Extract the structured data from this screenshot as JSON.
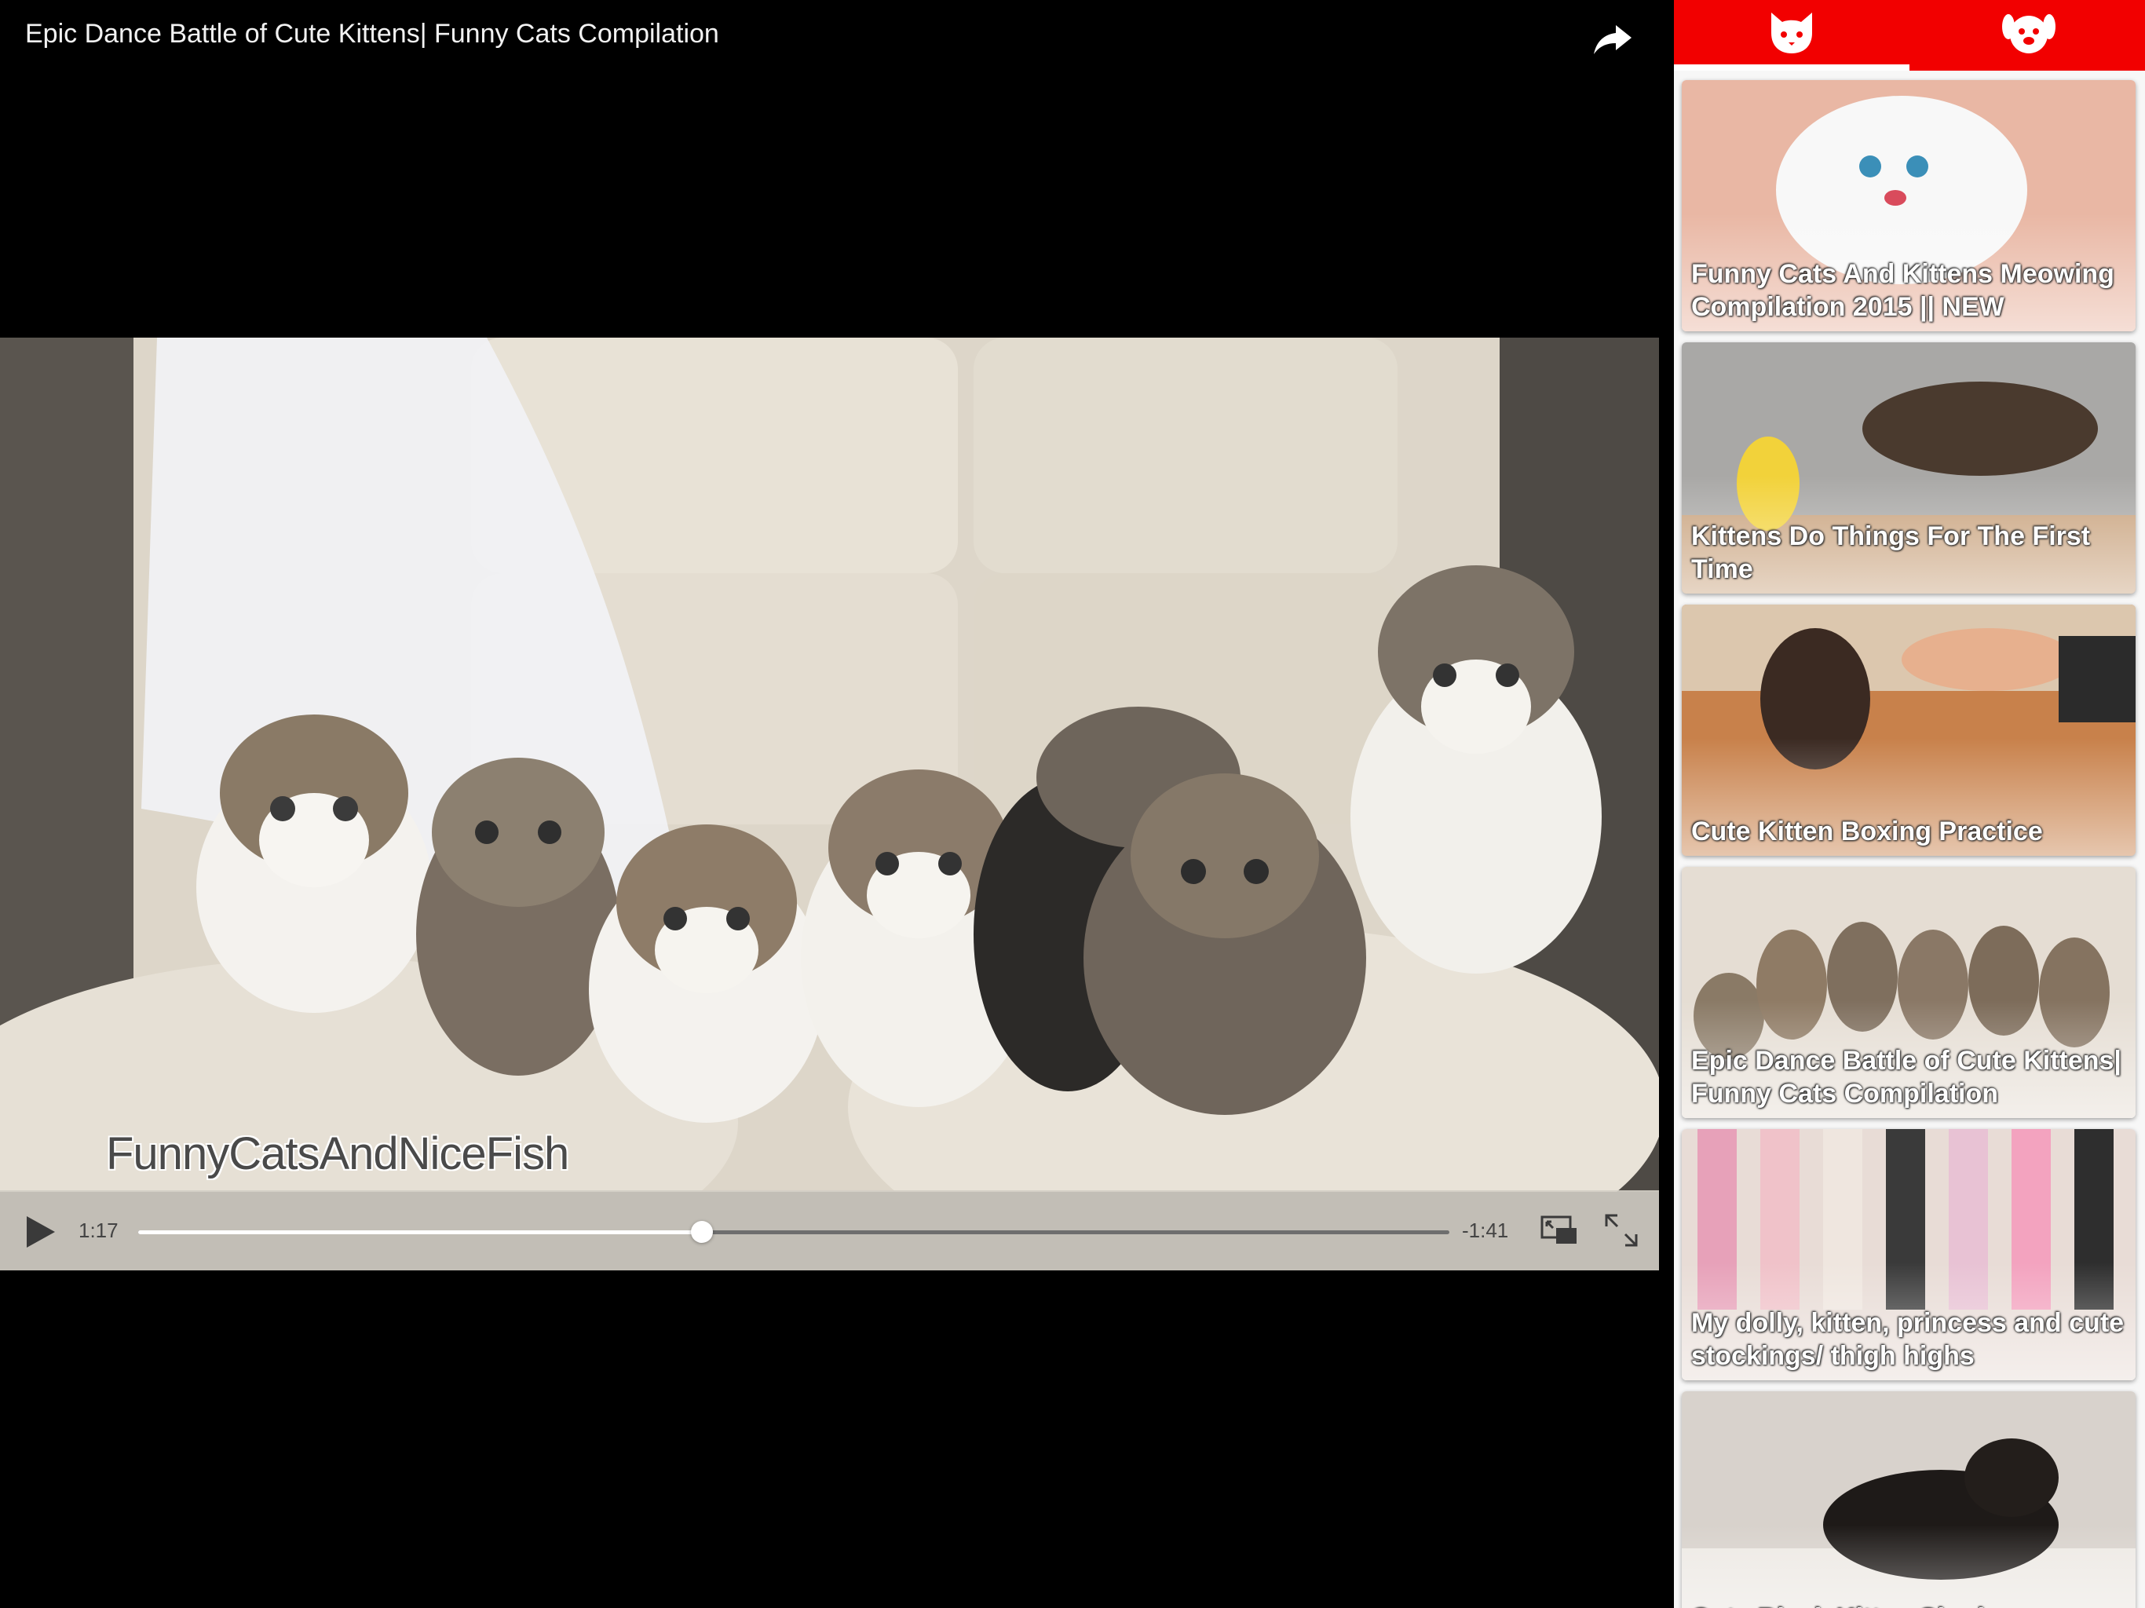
{
  "player": {
    "title": "Epic Dance Battle of Cute Kittens| Funny Cats Compilation",
    "watermark": "FunnyCatsAndNiceFish",
    "time_elapsed": "1:17",
    "time_remaining": "-1:41",
    "progress": 0.43
  },
  "sidebar": {
    "tabs": [
      {
        "icon": "cat-face-icon",
        "active": true
      },
      {
        "icon": "dog-face-icon",
        "active": false
      }
    ],
    "videos": [
      {
        "title": "Funny Cats And Kittens Meowing Compilation 2015 || NEW"
      },
      {
        "title": "Kittens Do Things For The First Time"
      },
      {
        "title": "Cute Kitten Boxing Practice"
      },
      {
        "title": "Epic Dance Battle of Cute Kittens| Funny Cats Compilation"
      },
      {
        "title": "My dolly, kitten, princess and cute stockings/ thigh highs"
      },
      {
        "title": "Cute Black Kitten Shadow"
      }
    ]
  },
  "colors": {
    "accent": "#f20000",
    "background": "#000000"
  }
}
